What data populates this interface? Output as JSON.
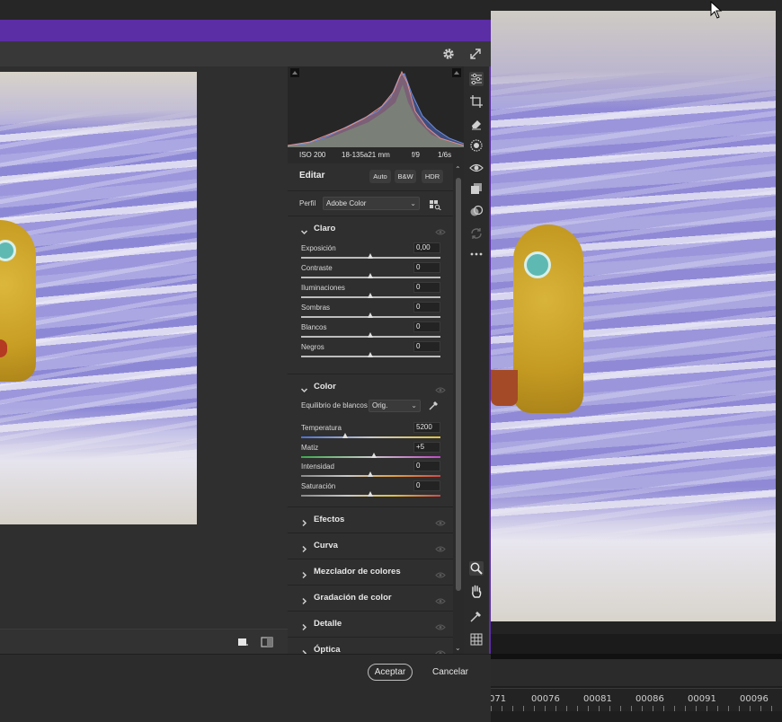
{
  "histogram_info": {
    "iso": "ISO 200",
    "lens": "18-135a21 mm",
    "aperture": "f/9",
    "shutter": "1/6s"
  },
  "edit": {
    "title": "Editar",
    "auto": "Auto",
    "bw": "B&W",
    "hdr": "HDR"
  },
  "profile": {
    "label": "Perfil",
    "value": "Adobe Color"
  },
  "light": {
    "title": "Claro",
    "sliders": [
      {
        "label": "Exposición",
        "value": "0,00"
      },
      {
        "label": "Contraste",
        "value": "0"
      },
      {
        "label": "Iluminaciones",
        "value": "0"
      },
      {
        "label": "Sombras",
        "value": "0"
      },
      {
        "label": "Blancos",
        "value": "0"
      },
      {
        "label": "Negros",
        "value": "0"
      }
    ]
  },
  "color": {
    "title": "Color",
    "wb_label": "Equilibrio de blancos",
    "wb_value": "Orig.",
    "sliders": [
      {
        "label": "Temperatura",
        "value": "5200"
      },
      {
        "label": "Matiz",
        "value": "+5"
      },
      {
        "label": "Intensidad",
        "value": "0"
      },
      {
        "label": "Saturación",
        "value": "0"
      }
    ]
  },
  "sections": [
    "Efectos",
    "Curva",
    "Mezclador de colores",
    "Gradación de color",
    "Detalle",
    "Óptica"
  ],
  "footer": {
    "accept": "Aceptar",
    "cancel": "Cancelar"
  },
  "timeline": {
    "timecodes": [
      "071",
      "00076",
      "00081",
      "00086",
      "00091",
      "00096"
    ]
  },
  "icons": {
    "toolbar": [
      "gear-icon",
      "expand-icon"
    ],
    "tools": [
      "edit-sliders-icon",
      "crop-icon",
      "eraser-icon",
      "mask-icon",
      "red-eye-icon",
      "presets-icon",
      "snapshots-icon",
      "sync-icon",
      "more-icon",
      "zoom-icon",
      "hand-icon",
      "color-sampler-icon",
      "grid-icon"
    ]
  }
}
